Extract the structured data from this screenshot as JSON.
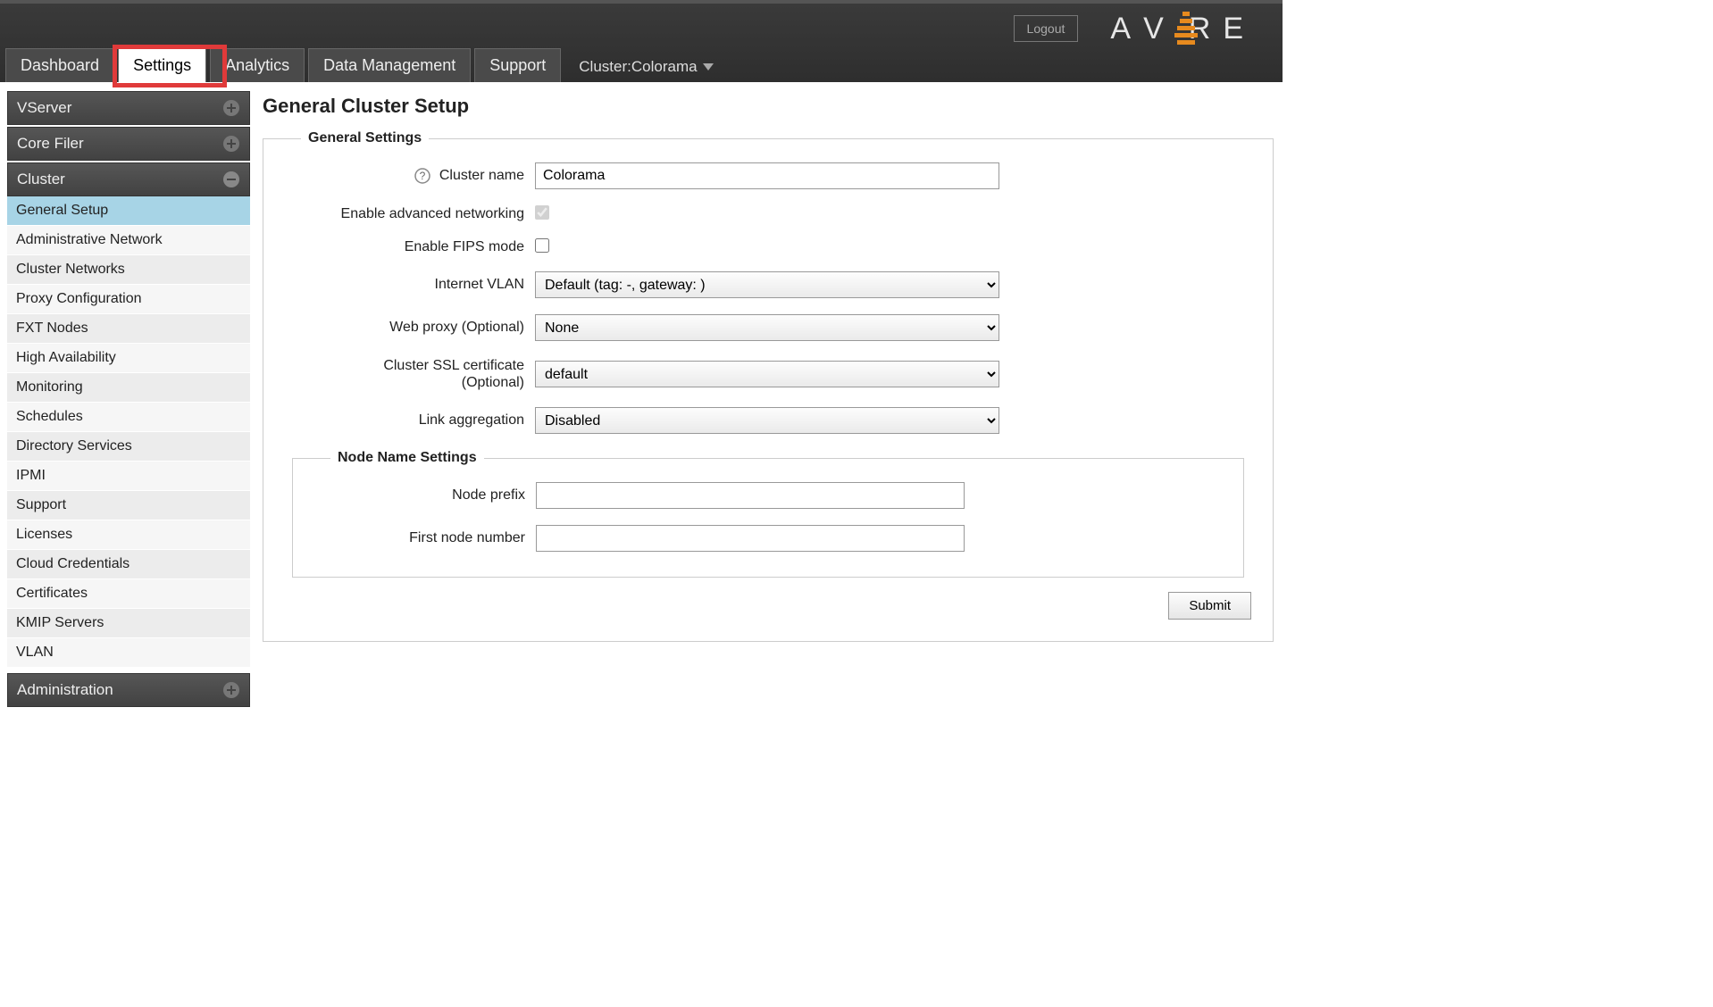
{
  "header": {
    "logout_label": "Logout",
    "logo_letters": {
      "a": "A",
      "v": "V",
      "r": "R",
      "e": "E"
    },
    "tabs": {
      "dashboard": "Dashboard",
      "settings": "Settings",
      "analytics": "Analytics",
      "data_mgmt": "Data Management",
      "support": "Support"
    },
    "cluster_prefix": "Cluster: ",
    "cluster_name": "Colorama"
  },
  "sidebar": {
    "sections": {
      "vserver": {
        "label": "VServer"
      },
      "corefiler": {
        "label": "Core Filer"
      },
      "cluster": {
        "label": "Cluster",
        "items": [
          "General Setup",
          "Administrative Network",
          "Cluster Networks",
          "Proxy Configuration",
          "FXT Nodes",
          "High Availability",
          "Monitoring",
          "Schedules",
          "Directory Services",
          "IPMI",
          "Support",
          "Licenses",
          "Cloud Credentials",
          "Certificates",
          "KMIP Servers",
          "VLAN"
        ]
      },
      "administration": {
        "label": "Administration"
      }
    }
  },
  "page": {
    "title": "General Cluster Setup",
    "fieldset_general": "General Settings",
    "fieldset_node": "Node Name Settings",
    "labels": {
      "cluster_name": "Cluster name",
      "adv_net": "Enable advanced networking",
      "fips": "Enable FIPS mode",
      "internet_vlan": "Internet VLAN",
      "web_proxy": "Web proxy (Optional)",
      "ssl_cert_line1": "Cluster SSL certificate",
      "ssl_cert_line2": "(Optional)",
      "link_agg": "Link aggregation",
      "node_prefix": "Node prefix",
      "first_node_num": "First node number"
    },
    "values": {
      "cluster_name": "Colorama",
      "adv_net_checked": true,
      "fips_checked": false,
      "internet_vlan": "Default (tag: -, gateway:               )",
      "web_proxy": "None",
      "ssl_cert": "default",
      "link_agg": "Disabled",
      "node_prefix": "",
      "first_node_num": ""
    },
    "submit_label": "Submit"
  }
}
